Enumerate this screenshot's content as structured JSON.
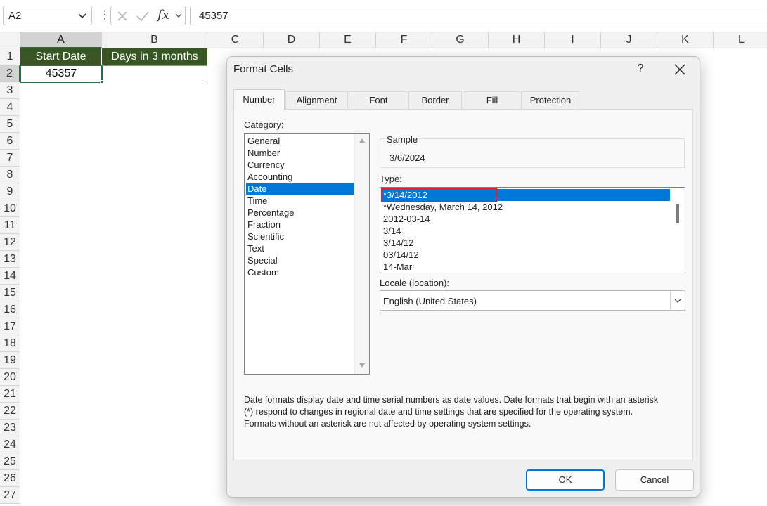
{
  "formula_bar": {
    "name_box": "A2",
    "formula": "45357",
    "cancel_icon": "x-icon",
    "enter_icon": "check-icon",
    "fx_label": "fx"
  },
  "sheet": {
    "columns": [
      "A",
      "B",
      "C",
      "D",
      "E",
      "F",
      "G",
      "H",
      "I",
      "J",
      "K",
      "L"
    ],
    "rows": [
      "1",
      "2",
      "3",
      "4",
      "5",
      "6",
      "7",
      "8",
      "9",
      "10",
      "11",
      "12",
      "13",
      "14",
      "15",
      "16",
      "17",
      "18",
      "19",
      "20",
      "21",
      "22",
      "23",
      "24",
      "25",
      "26",
      "27"
    ],
    "selected_column": "A",
    "selected_row": "2",
    "cells": {
      "A1": "Start Date",
      "B1": "Days in 3 months",
      "A2": "45357",
      "B2": ""
    },
    "header_fill": "#375623",
    "selection_color": "#217346"
  },
  "dialog": {
    "title": "Format Cells",
    "help": "?",
    "tabs": [
      "Number",
      "Alignment",
      "Font",
      "Border",
      "Fill",
      "Protection"
    ],
    "active_tab": "Number",
    "category_label": "Category:",
    "categories": [
      "General",
      "Number",
      "Currency",
      "Accounting",
      "Date",
      "Time",
      "Percentage",
      "Fraction",
      "Scientific",
      "Text",
      "Special",
      "Custom"
    ],
    "selected_category": "Date",
    "sample_label": "Sample",
    "sample_value": "3/6/2024",
    "type_label": "Type:",
    "types": [
      "*3/14/2012",
      "*Wednesday, March 14, 2012",
      "2012-03-14",
      "3/14",
      "3/14/12",
      "03/14/12",
      "14-Mar"
    ],
    "selected_type": "*3/14/2012",
    "locale_label": "Locale (location):",
    "locale_value": "English (United States)",
    "description": [
      "Date formats display date and time serial numbers as date values.  Date formats that begin with an asterisk",
      "(*) respond to changes in regional date and time settings that are specified for the operating system.",
      "Formats without an asterisk are not affected by operating system settings."
    ],
    "ok_label": "OK",
    "cancel_label": "Cancel",
    "highlight_color": "#e0202a",
    "selection_color": "#0078d7"
  }
}
